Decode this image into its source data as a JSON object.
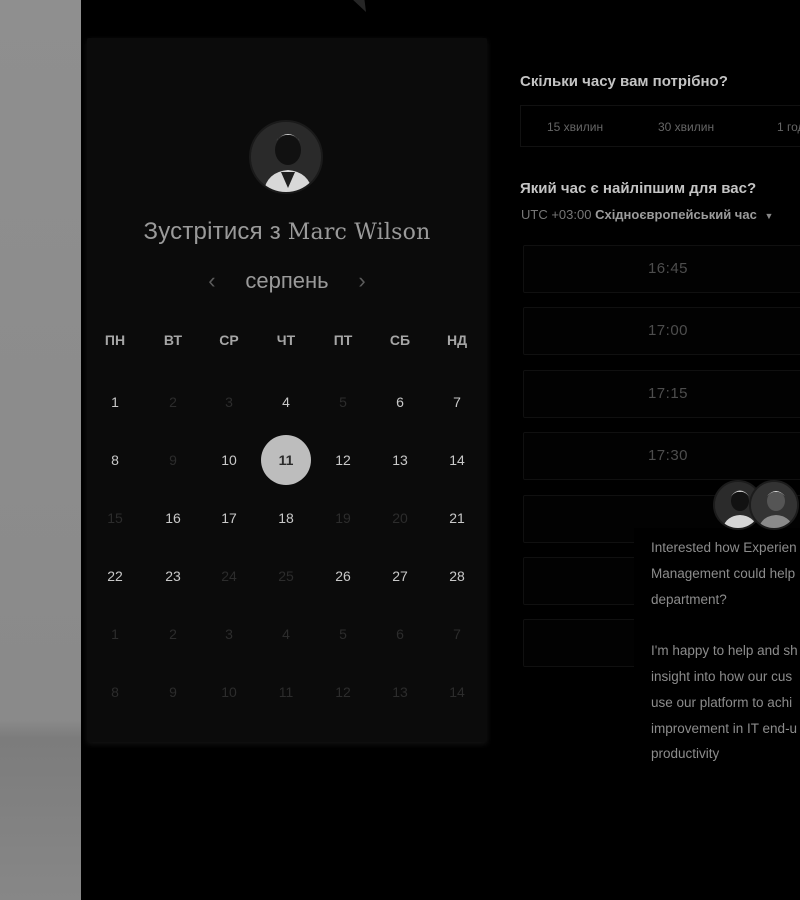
{
  "calendar": {
    "title_prefix": "Зустрітися з",
    "host_name": "Marc Wilson",
    "month": "серпень",
    "prev_icon": "chevron-left-icon",
    "next_icon": "chevron-right-icon",
    "weekdays": [
      "ПН",
      "ВТ",
      "СР",
      "ЧТ",
      "ПТ",
      "СБ",
      "НД"
    ],
    "weeks": [
      [
        {
          "d": "1",
          "s": "avail"
        },
        {
          "d": "2",
          "s": "dim"
        },
        {
          "d": "3",
          "s": "dim"
        },
        {
          "d": "4",
          "s": "avail"
        },
        {
          "d": "5",
          "s": "dim"
        },
        {
          "d": "6",
          "s": "avail"
        },
        {
          "d": "7",
          "s": "avail"
        }
      ],
      [
        {
          "d": "8",
          "s": "avail"
        },
        {
          "d": "9",
          "s": "dim"
        },
        {
          "d": "10",
          "s": "avail"
        },
        {
          "d": "11",
          "s": "selected"
        },
        {
          "d": "12",
          "s": "avail"
        },
        {
          "d": "13",
          "s": "avail"
        },
        {
          "d": "14",
          "s": "avail"
        }
      ],
      [
        {
          "d": "15",
          "s": "dim"
        },
        {
          "d": "16",
          "s": "avail"
        },
        {
          "d": "17",
          "s": "avail"
        },
        {
          "d": "18",
          "s": "avail"
        },
        {
          "d": "19",
          "s": "dim"
        },
        {
          "d": "20",
          "s": "dim"
        },
        {
          "d": "21",
          "s": "avail"
        }
      ],
      [
        {
          "d": "22",
          "s": "avail"
        },
        {
          "d": "23",
          "s": "avail"
        },
        {
          "d": "24",
          "s": "dim"
        },
        {
          "d": "25",
          "s": "dim"
        },
        {
          "d": "26",
          "s": "avail"
        },
        {
          "d": "27",
          "s": "avail"
        },
        {
          "d": "28",
          "s": "avail"
        }
      ],
      [
        {
          "d": "1",
          "s": "dim"
        },
        {
          "d": "2",
          "s": "dim"
        },
        {
          "d": "3",
          "s": "dim"
        },
        {
          "d": "4",
          "s": "dim"
        },
        {
          "d": "5",
          "s": "dim"
        },
        {
          "d": "6",
          "s": "dim"
        },
        {
          "d": "7",
          "s": "dim"
        }
      ],
      [
        {
          "d": "8",
          "s": "dim"
        },
        {
          "d": "9",
          "s": "dim"
        },
        {
          "d": "10",
          "s": "dim"
        },
        {
          "d": "11",
          "s": "dim"
        },
        {
          "d": "12",
          "s": "dim"
        },
        {
          "d": "13",
          "s": "dim"
        },
        {
          "d": "14",
          "s": "dim"
        }
      ]
    ]
  },
  "duration": {
    "question": "Скільки часу вам потрібно?",
    "options": [
      "15 хвилин",
      "30 хвилин",
      "1 год"
    ]
  },
  "time": {
    "question": "Який час є найліпшим для вас?",
    "tz_offset": "UTC +03:00",
    "tz_name": "Східноєвропейський час",
    "slots": [
      "16:45",
      "17:00",
      "17:15",
      "17:30"
    ]
  },
  "chat": {
    "lines": [
      "Interested how Experien",
      "Management could help",
      "department?",
      "",
      "I'm happy to help and sh",
      "insight into how our cus",
      "use our platform to achi",
      "improvement in IT end-u",
      "productivity"
    ]
  },
  "colors": {
    "selected_day_bg": "#bdbdbd",
    "panel_bg": "#0b0b0b",
    "page_bg": "#000000"
  }
}
